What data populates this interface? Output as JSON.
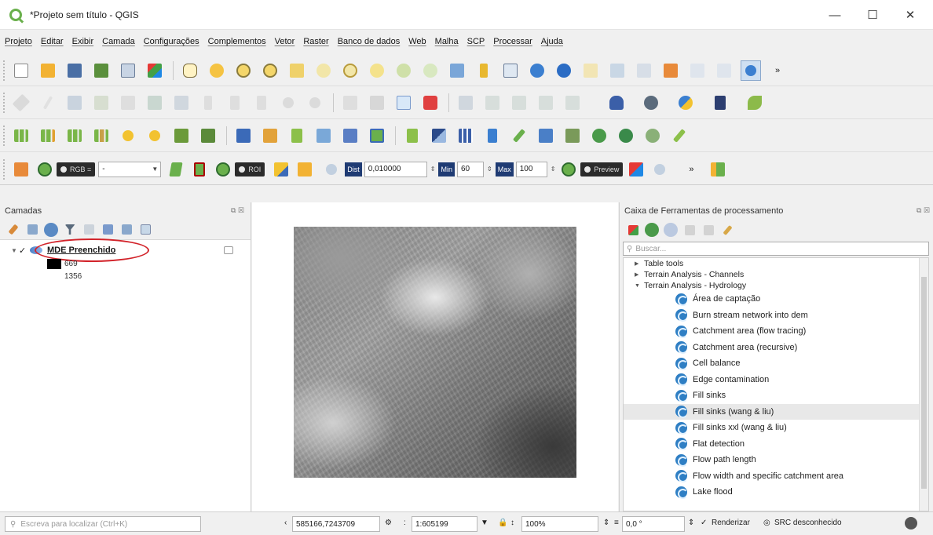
{
  "window": {
    "title": "*Projeto sem título - QGIS",
    "minimize": "—",
    "maximize": "☐",
    "close": "✕"
  },
  "menu": [
    "Projeto",
    "Editar",
    "Exibir",
    "Camada",
    "Configurações",
    "Complementos",
    "Vetor",
    "Raster",
    "Banco de dados",
    "Web",
    "Malha",
    "SCP",
    "Processar",
    "Ajuda"
  ],
  "toolbar1": {
    "icons": [
      "new-project",
      "open-project",
      "save-project",
      "save-as",
      "print-layout",
      "style-manager",
      "pan",
      "pan-to-selection",
      "zoom-in",
      "zoom-out",
      "zoom-full",
      "zoom-layer",
      "zoom-selection",
      "zoom-last",
      "zoom-next",
      "new-bookmark",
      "show-bookmarks",
      "refresh",
      "identify",
      "select",
      "attribute-table",
      "measure",
      "statistics",
      "decorations"
    ],
    "overflow": "»"
  },
  "toolbar2": {
    "icons": [
      "current-edits",
      "toggle-editing",
      "save-edits",
      "add-feature",
      "vertex-tool",
      "delete",
      "cut",
      "copy",
      "paste",
      "undo",
      "redo",
      "label-pin",
      "label-show",
      "label-move",
      "label-rotate",
      "label-change",
      "label-properties",
      "label-highlight",
      "db-manager",
      "python",
      "gps",
      "plugin-book",
      "grass"
    ]
  },
  "toolbar3": {
    "icons": [
      "raster-calc",
      "raster-add",
      "raster-style",
      "raster-info",
      "add-point",
      "add-line",
      "add-polygon",
      "add-ring",
      "georef",
      "layer-add",
      "vector-v",
      "draw-line",
      "raster-image",
      "zoom-box",
      "vector-v2",
      "grid-tool",
      "pattern",
      "edit-note",
      "pen",
      "chart",
      "globe-a",
      "globe-b",
      "globe-c",
      "brush"
    ]
  },
  "scp": {
    "rgb_label": "RGB =",
    "rgb_value": "-",
    "roi_label": "ROI",
    "dist_label": "Dist",
    "dist_value": "0,010000",
    "min_label": "Min",
    "min_value": "60",
    "max_label": "Max",
    "max_value": "100",
    "preview_label": "Preview",
    "overflow": "»"
  },
  "layers_panel": {
    "title": "Camadas",
    "layer_name": "MDE Preenchido",
    "legend_min": "669",
    "legend_max": "1356"
  },
  "toolbox": {
    "title": "Caixa de Ferramentas de processamento",
    "search_placeholder": "Buscar...",
    "groups": [
      {
        "label": "Table tools",
        "expanded": false
      },
      {
        "label": "Terrain Analysis - Channels",
        "expanded": false
      },
      {
        "label": "Terrain Analysis - Hydrology",
        "expanded": true
      }
    ],
    "algorithms": [
      "Área de captação",
      "Burn stream network into dem",
      "Catchment area (flow tracing)",
      "Catchment area (recursive)",
      "Cell balance",
      "Edge contamination",
      "Fill sinks",
      "Fill sinks (wang & liu)",
      "Fill sinks xxl (wang & liu)",
      "Flat detection",
      "Flow path length",
      "Flow width and specific catchment area",
      "Lake flood"
    ],
    "selected_index": 7
  },
  "status": {
    "locator_placeholder": "Escreva para localizar (Ctrl+K)",
    "coordinate": "585166,7243709",
    "scale": "1:605199",
    "magnifier": "100%",
    "rotation": "0,0 °",
    "render_label": "Renderizar",
    "crs_label": "SRC desconhecido"
  },
  "colors": {
    "accent": "#2f7fc4",
    "highlight_ellipse": "#d2232a",
    "dem_dark": "#3a3a3a",
    "dem_light": "#e8e8e8"
  }
}
